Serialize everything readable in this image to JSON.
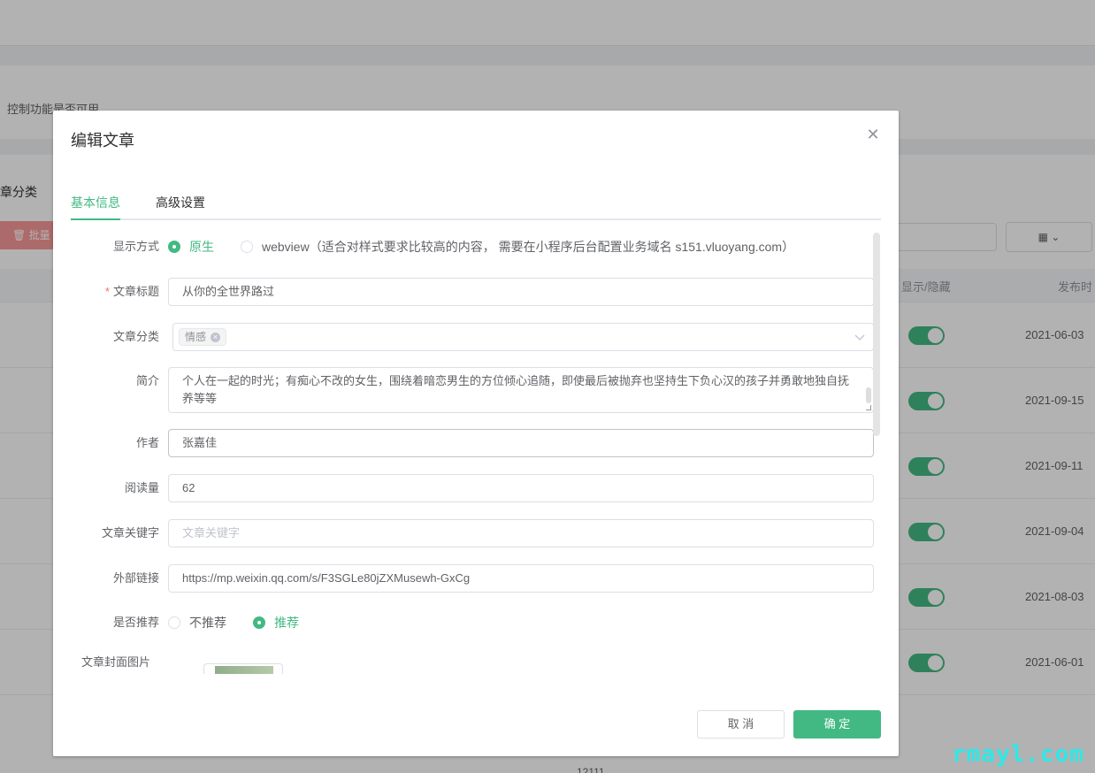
{
  "background": {
    "hint": "控制功能是否可用",
    "category": "章分类",
    "batch_button": "批量",
    "col_visible": "显示/隐藏",
    "col_publish": "发布时",
    "dates": [
      "2021-06-03",
      "2021-09-15",
      "2021-09-11",
      "2021-09-04",
      "2021-08-03",
      "2021-06-01"
    ],
    "footer": "12111"
  },
  "dialog": {
    "title": "编辑文章",
    "tabs": [
      {
        "label": "基本信息",
        "active": true
      },
      {
        "label": "高级设置",
        "active": false
      }
    ],
    "fields": {
      "display_mode": {
        "label": "显示方式",
        "options": [
          {
            "label": "原生",
            "checked": true
          },
          {
            "label": "webview（适合对样式要求比较高的内容， 需要在小程序后台配置业务域名 s151.vluoyang.com）",
            "checked": false
          }
        ]
      },
      "title": {
        "label": "文章标题",
        "value": "从你的全世界路过"
      },
      "category": {
        "label": "文章分类",
        "tag": "情感"
      },
      "summary": {
        "label": "简介",
        "value": "个人在一起的时光；有痴心不改的女生，围绕着暗恋男生的方位倾心追随，即使最后被抛弃也坚持生下负心汉的孩子并勇敢地独自抚养等等"
      },
      "author": {
        "label": "作者",
        "value": "张嘉佳"
      },
      "views": {
        "label": "阅读量",
        "value": "62"
      },
      "keywords": {
        "label": "文章关键字",
        "value": "",
        "placeholder": "文章关键字"
      },
      "link": {
        "label": "外部链接",
        "value": "https://mp.weixin.qq.com/s/F3SGLe80jZXMusewh-GxCg"
      },
      "recommend": {
        "label": "是否推荐",
        "options": [
          {
            "label": "不推荐",
            "checked": false
          },
          {
            "label": "推荐",
            "checked": true
          }
        ]
      },
      "cover": {
        "label": "文章封面图片"
      }
    },
    "buttons": {
      "cancel": "取 消",
      "ok": "确 定"
    }
  },
  "watermark": "rmayl.com",
  "colors": {
    "accent": "#42b983",
    "required": "#f56c6c"
  }
}
